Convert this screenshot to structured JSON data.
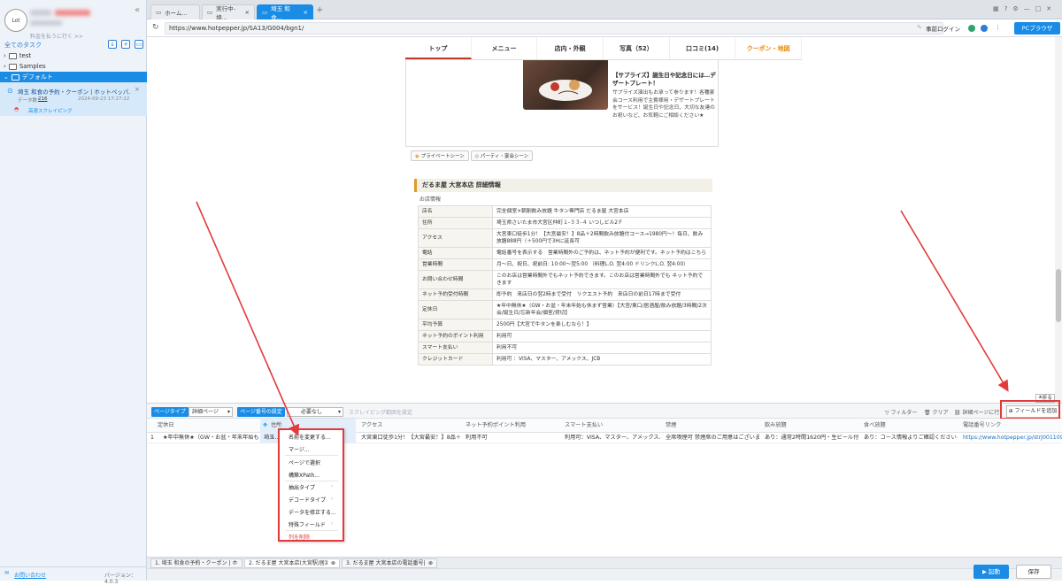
{
  "sidebar": {
    "upgrade": "料金を払うに行く >>",
    "all_tasks": "全てのタスク",
    "folders": [
      "test",
      "Samples",
      "デフォルト"
    ],
    "task": {
      "title": "埼玉 和食の予約・クーポン | ホットペッパ...",
      "data_label": "データ数：",
      "data_count": "216",
      "date": "2024-09-23 17:27:22",
      "mode": "高速スクレイピング"
    },
    "contact": "お問い合わせ",
    "version": "バージョン：4.0.3"
  },
  "tabs": [
    {
      "label": "ホーム..."
    },
    {
      "label": "実行中-埼..."
    },
    {
      "label": "埼玉 和食..."
    }
  ],
  "url": "https://www.hotpepper.jp/SA13/G004/bgn1/",
  "login_label": "事前ログイン",
  "browser_button": "PCブラウザ",
  "page": {
    "nav": [
      "トップ",
      "メニュー",
      "店内・外観",
      "写真（52）",
      "口コミ(14)",
      "クーポン・地図"
    ],
    "promo_title": "【サプライズ】誕生日や記念日には…デザートプレート！",
    "promo_body": "サプライズ演出もお承って参ります！各種宴会コース利用で主賓様用・デザートプレートをサービス！誕生日や記念日、大切な友達のお祝いなど、お気軽にご相談ください★",
    "scenes": [
      "プライベートシーン",
      "パーティ・宴会シーン"
    ],
    "detail_head": "だるま屋 大宮本店 詳細情報",
    "shop_info": "お店情報",
    "rows": [
      {
        "k": "店名",
        "v": "完全個室×朝割飲み放題 牛タン専門店 だるま屋 大宮本店"
      },
      {
        "k": "住所",
        "v": "埼玉県さいたま市大宮区仲町１-３３-４ いつしビル2Ｆ"
      },
      {
        "k": "アクセス",
        "v": "大宮東口徒歩1分！【大宮最安！】8品＋2時間飲み放題付コース→1980円〜！毎日、飲み放題888円（＋500円で3Hに延長可"
      },
      {
        "k": "電話",
        "v": "電話番号を表示する　営業時間外のご予約は、ネット予約が便利です。ネット予約はこちら"
      },
      {
        "k": "営業時間",
        "v": "月〜日、祝日、祝前日: 10:00〜翌5:00 （料理L.O. 翌4:00 ドリンクL.O. 翌4:00）"
      },
      {
        "k": "お問い合わせ時間",
        "v": "このお店は営業時間外でもネット予約できます。このお店は営業時間外でも ネット予約できます"
      },
      {
        "k": "ネット予約受付時間",
        "v": "即予約　来店日の翌2時まで受付　リクエスト予約　来店日の前日17時まで受付"
      },
      {
        "k": "定休日",
        "v": "★年中無休★（GW・お盆・年末年始も休まず営業）【大宮/東口/居酒屋/飲み放題/3時間/2次会/誕生日/忘新年会/個室/貸切】"
      },
      {
        "k": "平均予算",
        "v": "2500円【大宮で牛タンを楽しむなら！】"
      },
      {
        "k": "ネット予約のポイント利用",
        "v": "利用可"
      },
      {
        "k": "スマート支払い",
        "v": "利用不可"
      },
      {
        "k": "クレジットカード",
        "v": "利用可 ：VISA、マスター、アメックス、JCB"
      }
    ],
    "fold": "折る"
  },
  "toolbar": {
    "page_type": "ページタイプ",
    "page_type_value": "詳細ページ",
    "page_num": "ページ番号の設定",
    "page_num_value": "必要なし",
    "scrape_range": "スクレイピング範囲を設定",
    "filter": "フィルター",
    "clear": "クリア",
    "detail_link": "詳細ページに行",
    "add_field": "フィールドを追加"
  },
  "grid": {
    "headers": [
      "定休日",
      "住所",
      "アクセス",
      "ネット予約ポイント利用",
      "スマート支払い",
      "禁煙",
      "飲み放題",
      "食べ放題",
      "電話番号リンク"
    ],
    "row": [
      "★年中無休★（GW・お盆・年末年始も...",
      "埼玉...",
      "大宮東口徒歩1分！【大宮最安！】8品＋...",
      "利用不可",
      "利用可：VISA、マスター、アメックス、JCB",
      "全席喫煙可 禁煙席のご用意はございま...",
      "あり：通常2時間1620円・生ビール付ゲ...",
      "あり：コース情報よりご確認ください★",
      "https://www.hotpepper.jp/strJ001109849/"
    ],
    "row_num": "1"
  },
  "context_menu": {
    "items": [
      "名前を変更する...",
      "マージ...",
      "ページで選択",
      "構築XPath...",
      "抽出タイプ",
      "デコードタイプ",
      "データを修正する...",
      "特殊フィールド",
      "列を削除"
    ]
  },
  "bottom_tabs": [
    "1. 埼玉 和食の予約・クーポン | ホ...",
    "2. だるま屋 大宮本店(大宮駅/居酒...",
    "3. だるま屋 大宮本店の電話番号|..."
  ],
  "footer": {
    "start": "起動",
    "save": "保存"
  }
}
